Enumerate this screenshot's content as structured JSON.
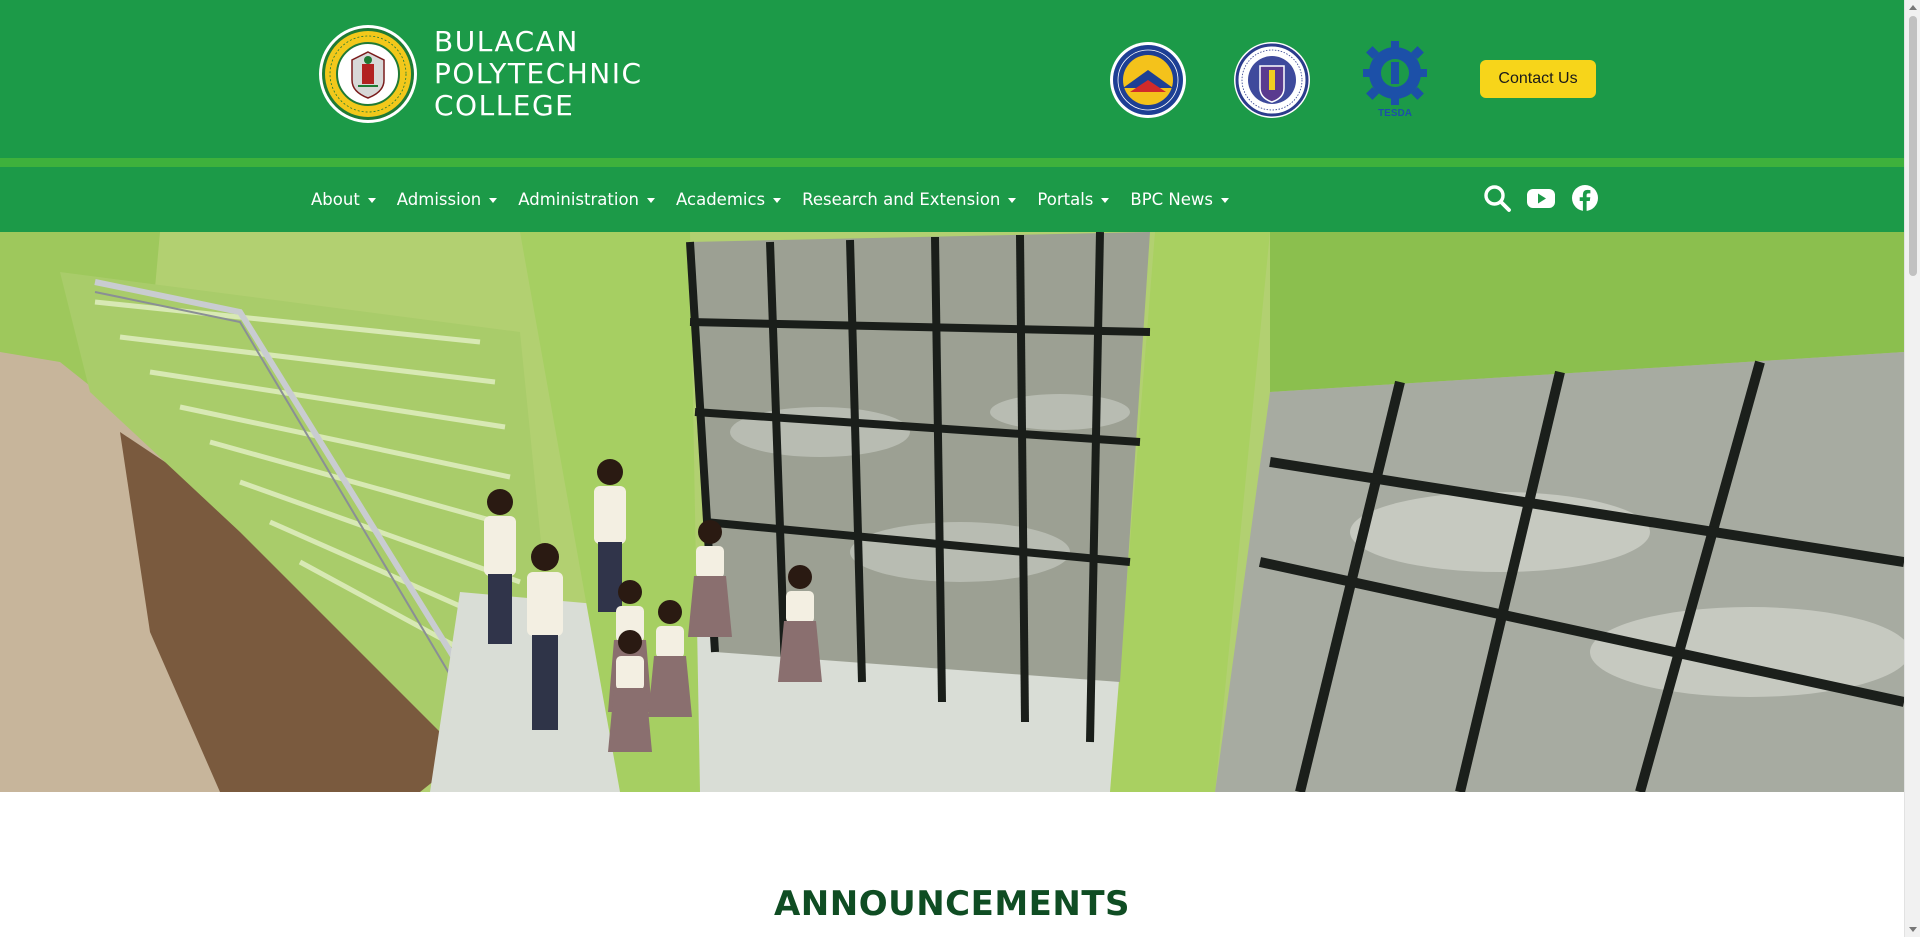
{
  "header": {
    "brand_lines": [
      "BULACAN",
      "POLYTECHNIC",
      "COLLEGE"
    ],
    "logo_text": "BULACAN POLYTECHNIC COLLEGE",
    "agency_logos": [
      {
        "name": "ched-logo",
        "text": "COMMISSION ON HIGHER EDUCATION"
      },
      {
        "name": "deped-logo",
        "text": "KAGAWARAN NG EDUKASYON"
      },
      {
        "name": "tesda-logo",
        "text": "TESDA"
      }
    ],
    "contact_label": "Contact Us"
  },
  "nav": {
    "items": [
      {
        "label": "About"
      },
      {
        "label": "Admission"
      },
      {
        "label": "Administration"
      },
      {
        "label": "Academics"
      },
      {
        "label": "Research and Extension"
      },
      {
        "label": "Portals"
      },
      {
        "label": "BPC News"
      }
    ],
    "icons": [
      "search-icon",
      "youtube-icon",
      "facebook-icon"
    ]
  },
  "main": {
    "section_title": "ANNOUNCEMENTS"
  },
  "colors": {
    "header_green": "#1c9a48",
    "stripe_green": "#3eb13c",
    "contact_yellow": "#f7d51a",
    "title_green": "#0f4d23"
  }
}
